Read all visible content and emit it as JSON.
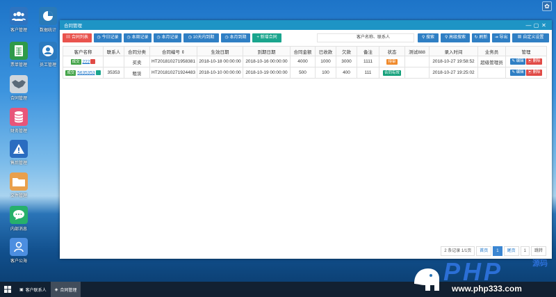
{
  "desktop": {
    "icons": [
      {
        "label": "客户管理",
        "color": "#2f74c0"
      },
      {
        "label": "数据统计",
        "color": "#2a7ab8"
      },
      {
        "label": "票单管理",
        "color": "#2e9a4a"
      },
      {
        "label": "员工管理",
        "color": "#2b7ac0"
      },
      {
        "label": "合同管理",
        "color": "#cfd6dc"
      },
      {
        "label": "财务管理",
        "color": "#e8557a"
      },
      {
        "label": "售后管理",
        "color": "#2a6cc0"
      },
      {
        "label": "文件管理",
        "color": "#e9a04c"
      },
      {
        "label": "内部消息",
        "color": "#27b06b"
      },
      {
        "label": "客户公海",
        "color": "#4c8ee0"
      }
    ]
  },
  "window": {
    "title": "合同管理",
    "controls": {
      "minimize": "—",
      "maximize": "▢",
      "close": "✕"
    }
  },
  "toolbar": {
    "buttons": [
      {
        "label": "合同列表",
        "icon": "list-icon",
        "style": "red"
      },
      {
        "label": "今日记录",
        "icon": "clock-icon",
        "style": "blue"
      },
      {
        "label": "本周记录",
        "icon": "clock-icon",
        "style": "blue"
      },
      {
        "label": "本月记录",
        "icon": "clock-icon",
        "style": "blue"
      },
      {
        "label": "10天内到期",
        "icon": "clock-icon",
        "style": "blue"
      },
      {
        "label": "本月到期",
        "icon": "clock-icon",
        "style": "blue"
      },
      {
        "label": "新增合同",
        "icon": "plus-icon",
        "style": "teal"
      }
    ],
    "search_placeholder": "客户名称、联系人",
    "right_buttons": [
      {
        "label": "搜索",
        "icon": "search-icon"
      },
      {
        "label": "高级搜索",
        "icon": "search-icon"
      },
      {
        "label": "刷新",
        "icon": "refresh-icon"
      },
      {
        "label": "导出",
        "icon": "export-icon"
      },
      {
        "label": "自定义设置",
        "icon": "settings-icon"
      }
    ]
  },
  "table": {
    "columns": [
      "客户名称",
      "联系人",
      "合同分类",
      "合同编号 ⇕",
      "生效日期",
      "到期日期",
      "合同金额",
      "已收款",
      "欠款",
      "备注",
      "状态",
      "测试888",
      "录入时间",
      "业务员",
      "管理"
    ],
    "rows": [
      {
        "tag": "成交",
        "name": "222",
        "flag_color": "#e04a46",
        "contact": "",
        "category": "买卖",
        "number": "HT201810271958381",
        "start": "2018-10-18 00:00:00",
        "end": "2018-10-16 00:00:00",
        "amount": "4000",
        "received": "1000",
        "owed": "3000",
        "remark": "1111",
        "status": "待审",
        "status_style": "orange",
        "test": "",
        "created": "2018-10-27 19:58:52",
        "salesman": "超级管理员",
        "edit": "编辑",
        "del": "删除"
      },
      {
        "tag": "成交",
        "name": "5635353",
        "flag_color": "#1aa58d",
        "contact": "35353",
        "category": "租赁",
        "number": "HT201810271924483",
        "start": "2018-10-10 00:00:00",
        "end": "2018-10-19 00:00:00",
        "amount": "500",
        "received": "100",
        "owed": "400",
        "remark": "111",
        "status": "合同有效",
        "status_style": "teal",
        "test": "",
        "created": "2018-10-27 19:25:02",
        "salesman": "",
        "edit": "编辑",
        "del": "删除"
      }
    ]
  },
  "pager": {
    "summary": "2 条记录 1/1页",
    "first": "首页",
    "current": "1",
    "last": "尾页",
    "goto_value": "1",
    "jump": "跳转"
  },
  "taskbar": {
    "items": [
      {
        "label": "客户联系人"
      },
      {
        "label": "合同管理"
      }
    ]
  },
  "watermark": {
    "brand": "PHP",
    "cn": "源码",
    "url": "www.php333.com"
  }
}
